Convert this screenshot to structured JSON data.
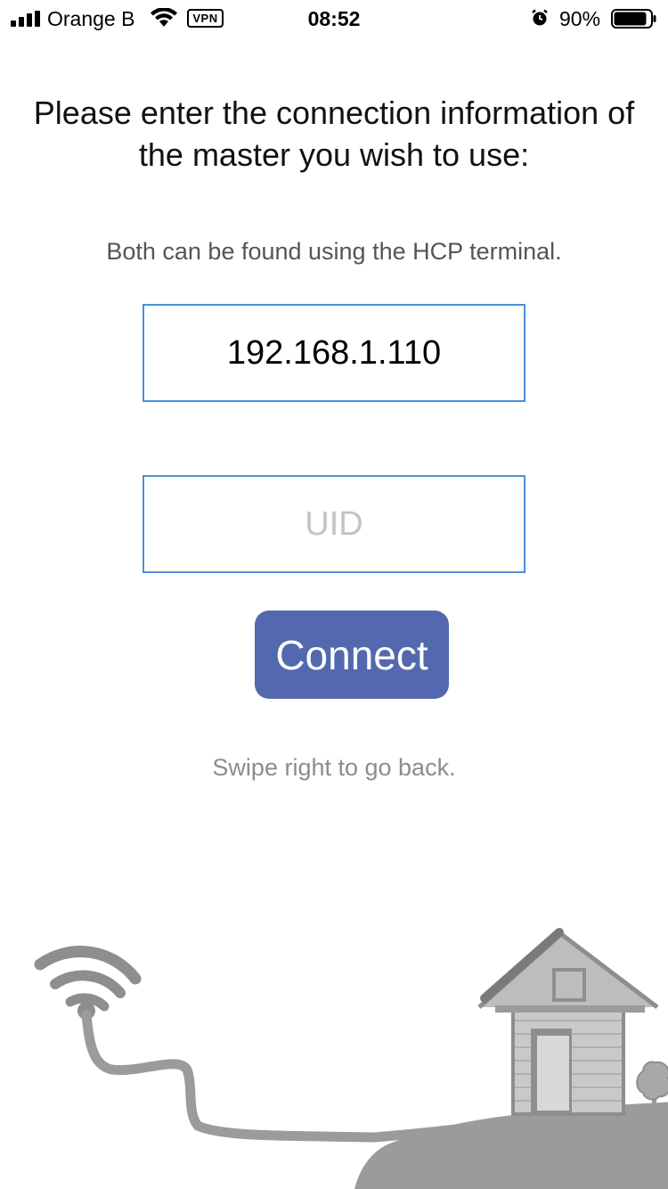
{
  "status_bar": {
    "carrier": "Orange B",
    "vpn_label": "VPN",
    "time": "08:52",
    "battery_percent": "90%",
    "battery_level": 0.9,
    "icons": [
      "signal-icon",
      "wifi-icon",
      "alarm-icon",
      "battery-icon"
    ]
  },
  "main": {
    "title": "Please enter the connection information of the master you wish to use:",
    "subtitle": "Both can be found using the HCP terminal.",
    "ip_field": {
      "value": "192.168.1.110",
      "placeholder": ""
    },
    "uid_field": {
      "value": "",
      "placeholder": "UID"
    },
    "connect_label": "Connect",
    "hint": "Swipe right to go back."
  },
  "colors": {
    "accent": "#5368ae",
    "field_border": "#4a90d9",
    "illustration_gray": "#9b9b9b"
  }
}
